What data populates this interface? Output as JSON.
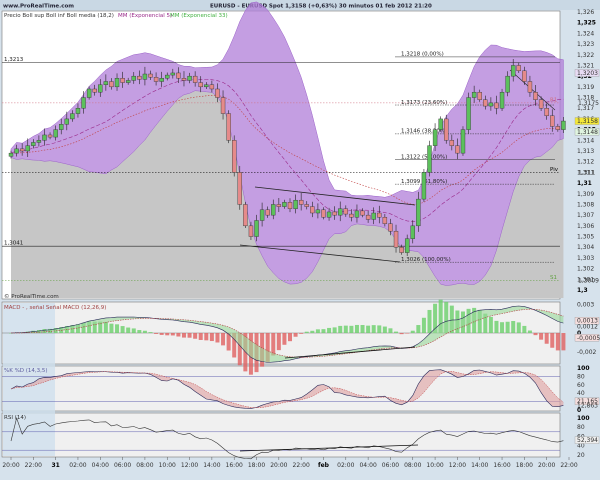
{
  "header": {
    "site": "www.ProRealTime.com",
    "title": "EURUSD - EURUSD Spot   1,3158 (+0,63%)   30 minutos  01 feb 2012 21:20"
  },
  "legend": {
    "main_a": "Precio Boll sup Boll inf Boll media (18,2)",
    "main_b": "MM (Exponencial 5)",
    "main_c": "MM (Exponencial 33)",
    "watermark": "© ProRealTime.com",
    "macd": "MACD - , señal Señal MACD (12,26,9)",
    "stoch": "%K %D (14,3,5)",
    "rsi": "RSI (14)"
  },
  "colors": {
    "up": "#5cc05c",
    "down": "#e58a8a",
    "band": "#b07ed8",
    "gray": "#c6c6c6",
    "ema5": "#9a2a8a",
    "ema33": "#c04040",
    "axis_bg": "#d6e2ec",
    "highlight": "#f4e83a"
  },
  "levels": {
    "h1": {
      "value": 1.3213,
      "label": "1,3213"
    },
    "h2": {
      "value": 1.3041,
      "label": "1,3041"
    },
    "fib": [
      {
        "value": 1.3218,
        "label": "1,3218 (0,00%)"
      },
      {
        "value": 1.3173,
        "label": "1,3173 (23,60%)"
      },
      {
        "value": 1.3146,
        "label": "1,3146 (38,20%)"
      },
      {
        "value": 1.3122,
        "label": "1,3122 (50,00%)"
      },
      {
        "value": 1.3099,
        "label": "1,3099 (61,80%)"
      },
      {
        "value": 1.3026,
        "label": "1,3026 (100,00%)"
      }
    ],
    "pivots": [
      {
        "value": 1.3175,
        "tag": "R1",
        "label": "1,3175",
        "color": "#d07080"
      },
      {
        "value": 1.311,
        "tag": "Piv",
        "label": "1,311",
        "color": "#000000"
      },
      {
        "value": 1.3009,
        "tag": "S1",
        "label": "1,3009",
        "color": "#60a040"
      }
    ],
    "last": {
      "value": 1.3158,
      "label": "1,3158"
    },
    "band_up_label": {
      "value": 1.3203,
      "label": "1,3203"
    },
    "ema_label": {
      "value": 1.3148,
      "label": "1,3148"
    }
  },
  "chart_data": [
    {
      "type": "candlestick",
      "title": "EURUSD - EURUSD Spot 30 minutos",
      "interval_minutes": 30,
      "start": "30 ene 2012 20:00",
      "closes": [
        1.3128,
        1.3132,
        1.313,
        1.3135,
        1.3138,
        1.314,
        1.3145,
        1.3143,
        1.315,
        1.3155,
        1.316,
        1.3165,
        1.317,
        1.318,
        1.3188,
        1.3185,
        1.3192,
        1.3195,
        1.319,
        1.3198,
        1.3194,
        1.3196,
        1.32,
        1.3197,
        1.3202,
        1.3199,
        1.3195,
        1.3198,
        1.3201,
        1.3203,
        1.3198,
        1.3196,
        1.32,
        1.3194,
        1.319,
        1.3192,
        1.3188,
        1.318,
        1.3165,
        1.314,
        1.311,
        1.308,
        1.306,
        1.305,
        1.3065,
        1.3075,
        1.307,
        1.308,
        1.3078,
        1.3082,
        1.3076,
        1.3084,
        1.308,
        1.3078,
        1.3072,
        1.3075,
        1.3068,
        1.3073,
        1.307,
        1.3076,
        1.3071,
        1.3068,
        1.3074,
        1.307,
        1.3066,
        1.3072,
        1.3068,
        1.3062,
        1.3055,
        1.304,
        1.3035,
        1.3048,
        1.306,
        1.3085,
        1.311,
        1.3135,
        1.315,
        1.316,
        1.314,
        1.3135,
        1.3128,
        1.315,
        1.318,
        1.3185,
        1.3178,
        1.3172,
        1.3175,
        1.317,
        1.3185,
        1.32,
        1.321,
        1.3205,
        1.3195,
        1.3185,
        1.3178,
        1.317,
        1.3163,
        1.3153,
        1.315,
        1.3158
      ],
      "ylim": [
        1.3,
        1.326
      ],
      "yticks": [
        "1,326",
        "1,325",
        "1,324",
        "1,323",
        "1,322",
        "1,321",
        "1,32",
        "1,319",
        "1,318",
        "1,317",
        "1,316",
        "1,315",
        "1,314",
        "1,313",
        "1,312",
        "1,311",
        "1,31",
        "1,309",
        "1,308",
        "1,307",
        "1,306",
        "1,305",
        "1,304",
        "1,303",
        "1,302",
        "1,301",
        "1,3"
      ],
      "bollinger": {
        "period": 18,
        "k": 2
      },
      "ema": [
        5,
        33
      ]
    },
    {
      "type": "macd",
      "params": [
        12,
        26,
        9
      ],
      "ylim": [
        -0.003,
        0.003
      ],
      "yticks": [
        "0,003",
        "0",
        "-0,002"
      ],
      "values_shown": [
        "0,0013",
        "0,0012",
        "-0,0005"
      ]
    },
    {
      "type": "stochastic",
      "params": [
        14,
        3,
        5
      ],
      "ylim": [
        0,
        100
      ],
      "yticks": [
        "100",
        "80",
        "60",
        "40",
        "0"
      ],
      "values_shown": [
        "21,165",
        "12,863"
      ]
    },
    {
      "type": "rsi",
      "params": [
        14
      ],
      "ylim": [
        0,
        100
      ],
      "yticks": [
        "100",
        "80",
        "60",
        "40",
        "20"
      ],
      "values_shown": [
        "52,394"
      ]
    }
  ],
  "xticks": [
    "20:00",
    "22:00",
    "31",
    "02:00",
    "04:00",
    "06:00",
    "08:00",
    "10:00",
    "12:00",
    "14:00",
    "16:00",
    "18:00",
    "20:00",
    "22:00",
    "feb",
    "02:00",
    "04:00",
    "06:00",
    "08:00",
    "10:00",
    "12:00",
    "14:00",
    "16:00",
    "18:00",
    "20:00",
    "22:00"
  ]
}
